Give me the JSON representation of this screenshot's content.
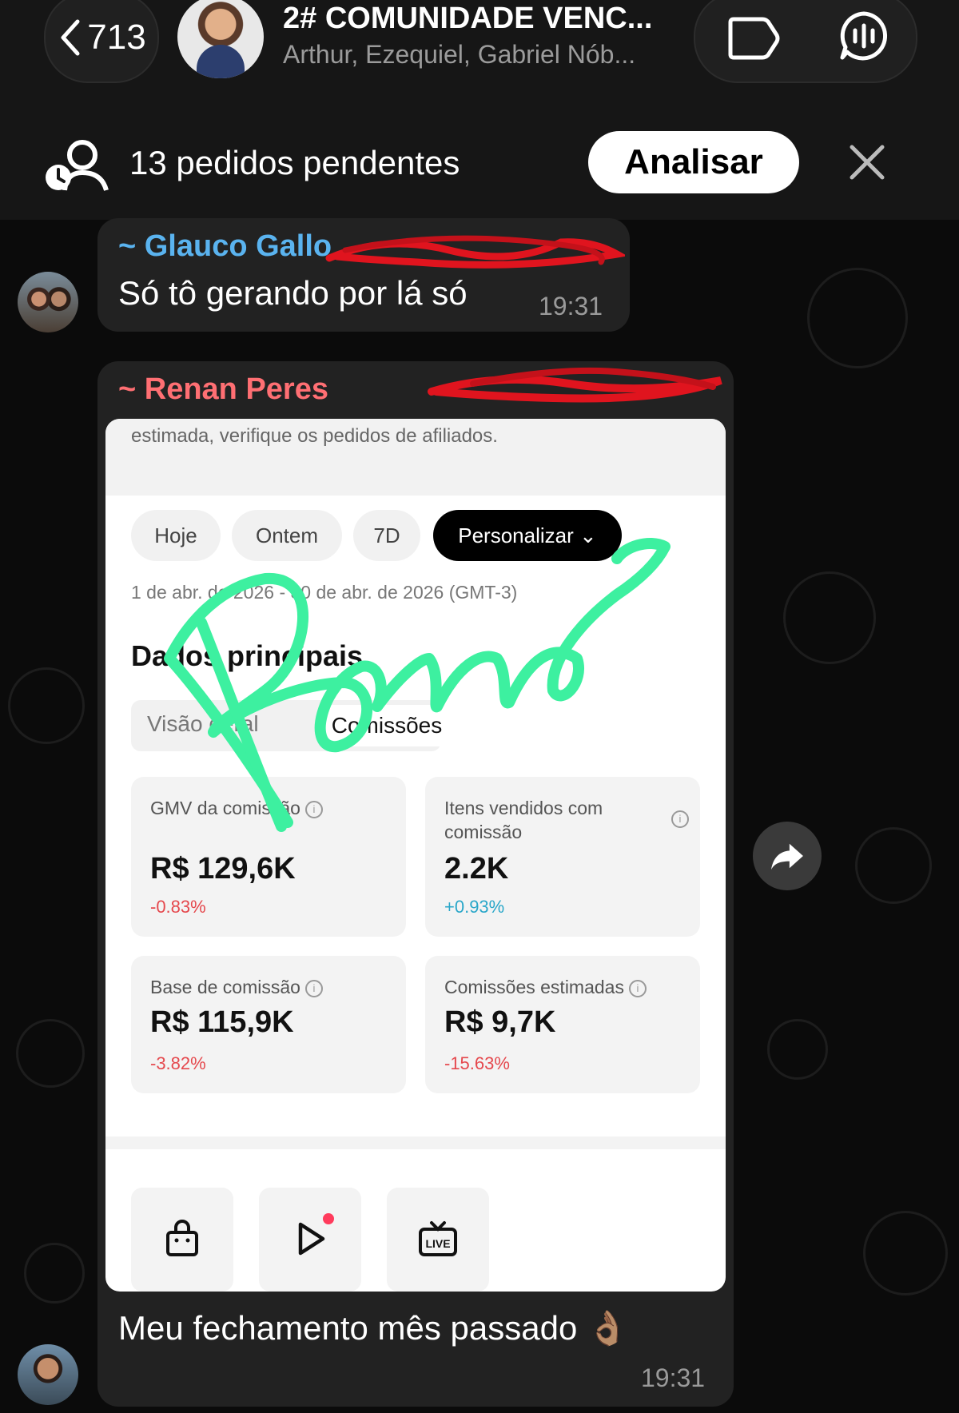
{
  "header": {
    "back_count": "713",
    "group_title": "2# COMUNIDADE VENC...",
    "group_members": "Arthur, Ezequiel, Gabriel Nób..."
  },
  "pending": {
    "text": "13 pedidos pendentes",
    "button_label": "Analisar"
  },
  "messages": [
    {
      "sender": "~ Glauco Gallo",
      "text": "Só tô gerando por lá só",
      "time": "19:31"
    },
    {
      "sender": "~ Renan Peres",
      "text": "Meu fechamento mês passado 👌🏽",
      "time": "19:31",
      "screenshot": {
        "top_text": "estimada, verifique os pedidos de afiliados.",
        "periods": [
          "Hoje",
          "Ontem",
          "7D",
          "Personalizar ⌄"
        ],
        "date_range": "1 de abr. de 2026 - 30 de abr. de 2026 (GMT-3)",
        "section_title": "Dados principais",
        "tabs": [
          "Visão geral",
          "Comissões"
        ],
        "cards": [
          {
            "label": "GMV da comissão",
            "value": "R$ 129,6K",
            "change": "-0.83%"
          },
          {
            "label": "Itens vendidos com comissão",
            "value": "2.2K",
            "change": "+0.93%"
          },
          {
            "label": "Base de comissão",
            "value": "R$ 115,9K",
            "change": "-3.82%"
          },
          {
            "label": "Comissões estimadas",
            "value": "R$ 9,7K",
            "change": "-15.63%"
          }
        ],
        "tools": [
          "shop-bag-icon",
          "video-play-icon",
          "live-icon"
        ],
        "live_label": "LIVE"
      }
    }
  ],
  "colors": {
    "sender1": "#5ab3ef",
    "sender2": "#ff6f73",
    "scribble": "#3df0a0",
    "redaction": "#e0141e"
  }
}
